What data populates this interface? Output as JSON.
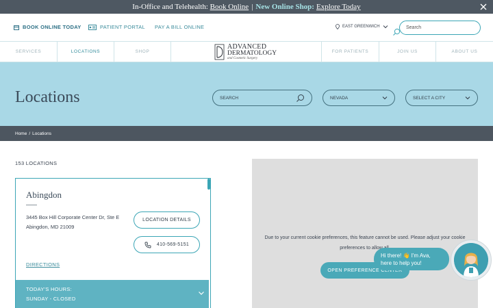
{
  "banner": {
    "lead": "In-Office and Telehealth:",
    "book_online": "Book Online",
    "separator": "|",
    "new_shop": "New Online Shop:",
    "explore": "Explore Today"
  },
  "utility": {
    "book_today": "BOOK ONLINE TODAY",
    "patient_portal": "PATIENT PORTAL",
    "pay_bill": "PAY A BILL ONLINE",
    "location": "EAST GREENWICH",
    "search_placeholder": "Search"
  },
  "nav": {
    "services": "SERVICES",
    "locations": "LOCATIONS",
    "shop": "SHOP",
    "for_patients": "FOR PATIENTS",
    "join_us": "JOIN US",
    "about_us": "ABOUT US"
  },
  "logo": {
    "line1": "ADVANCED",
    "line2": "DERMATOLOGY",
    "line3": "and Cosmetic Surgery"
  },
  "hero": {
    "title": "Locations",
    "search_placeholder": "SEARCH",
    "state_value": "NEVADA",
    "city_placeholder": "SELECT A CITY"
  },
  "breadcrumb": {
    "home": "Home",
    "sep": "/",
    "current": "Locations"
  },
  "results": {
    "count": "153 LOCATIONS"
  },
  "location_card": {
    "name": "Abingdon",
    "address_line1": "3445 Box Hill Corporate Center Dr, Ste E",
    "address_line2": "Abingdon, MD 21009",
    "details_label": "LOCATION DETAILS",
    "phone": "410-569-5151",
    "directions": "DIRECTIONS",
    "hours_label": "TODAY'S HOURS:",
    "hours_value": "SUNDAY - CLOSED"
  },
  "map": {
    "message": "Due to your current cookie preferences, this feature cannot be used. Please adjust your cookie preferences to allow all.",
    "button": "OPEN PREFERENCE CENTER"
  },
  "chat": {
    "greeting": "Hi there! 👋 I'm Ava, here to help you!"
  },
  "colors": {
    "teal": "#3aa5b5",
    "hero_bg": "#a9d8e6",
    "dark_bar": "#4d5660",
    "map_bg": "#dedede"
  }
}
